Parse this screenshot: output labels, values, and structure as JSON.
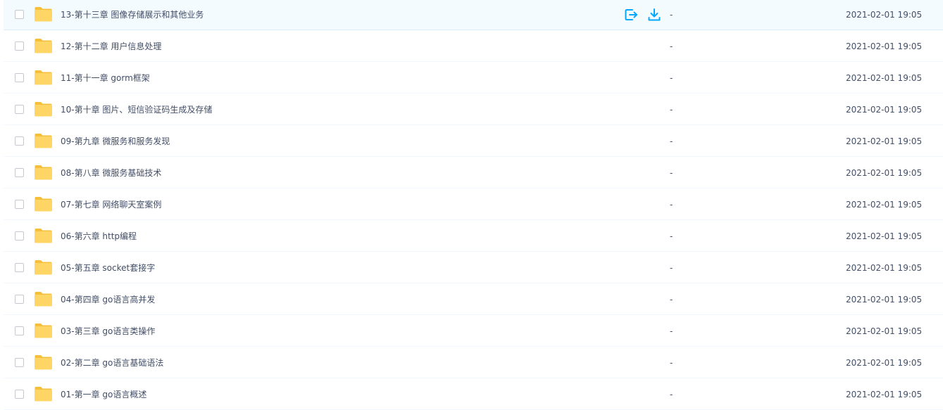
{
  "colors": {
    "accent": "#06a7ff",
    "folder": "#ffd665",
    "folder_back": "#f5bf3b",
    "hover_bg": "#f4fbff"
  },
  "row_actions": {
    "share_icon": "share-out-icon",
    "download_icon": "download-icon"
  },
  "files": [
    {
      "name": "13-第十三章 图像存储展示和其他业务",
      "size": "-",
      "modified": "2021-02-01 19:05",
      "hovered": true,
      "icon": "folder-icon"
    },
    {
      "name": "12-第十二章 用户信息处理",
      "size": "-",
      "modified": "2021-02-01 19:05",
      "icon": "folder-icon"
    },
    {
      "name": "11-第十一章 gorm框架",
      "size": "-",
      "modified": "2021-02-01 19:05",
      "icon": "folder-icon"
    },
    {
      "name": "10-第十章 图片、短信验证码生成及存储",
      "size": "-",
      "modified": "2021-02-01 19:05",
      "icon": "folder-icon"
    },
    {
      "name": "09-第九章 微服务和服务发现",
      "size": "-",
      "modified": "2021-02-01 19:05",
      "icon": "folder-icon"
    },
    {
      "name": "08-第八章 微服务基础技术",
      "size": "-",
      "modified": "2021-02-01 19:05",
      "icon": "folder-icon"
    },
    {
      "name": "07-第七章 网络聊天室案例",
      "size": "-",
      "modified": "2021-02-01 19:05",
      "icon": "folder-icon"
    },
    {
      "name": "06-第六章 http编程",
      "size": "-",
      "modified": "2021-02-01 19:05",
      "icon": "folder-icon"
    },
    {
      "name": "05-第五章 socket套接字",
      "size": "-",
      "modified": "2021-02-01 19:05",
      "icon": "folder-icon"
    },
    {
      "name": "04-第四章 go语言高并发",
      "size": "-",
      "modified": "2021-02-01 19:05",
      "icon": "folder-icon"
    },
    {
      "name": "03-第三章 go语言类操作",
      "size": "-",
      "modified": "2021-02-01 19:05",
      "icon": "folder-icon"
    },
    {
      "name": "02-第二章 go语言基础语法",
      "size": "-",
      "modified": "2021-02-01 19:05",
      "icon": "folder-icon"
    },
    {
      "name": "01-第一章 go语言概述",
      "size": "-",
      "modified": "2021-02-01 19:05",
      "icon": "folder-icon"
    }
  ]
}
